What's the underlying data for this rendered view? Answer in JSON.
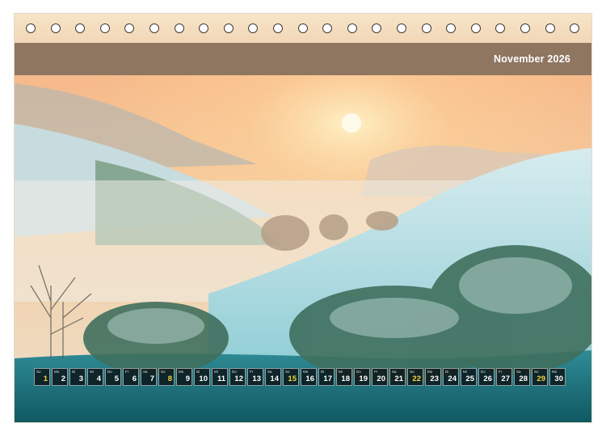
{
  "calendar": {
    "title": "November 2026",
    "days": [
      {
        "wd": "So",
        "n": "1",
        "kind": "sun"
      },
      {
        "wd": "Mo",
        "n": "2",
        "kind": ""
      },
      {
        "wd": "Di",
        "n": "3",
        "kind": ""
      },
      {
        "wd": "Mi",
        "n": "4",
        "kind": ""
      },
      {
        "wd": "Do",
        "n": "5",
        "kind": ""
      },
      {
        "wd": "Fr",
        "n": "6",
        "kind": ""
      },
      {
        "wd": "Sa",
        "n": "7",
        "kind": ""
      },
      {
        "wd": "So",
        "n": "8",
        "kind": "sun"
      },
      {
        "wd": "Mo",
        "n": "9",
        "kind": ""
      },
      {
        "wd": "Di",
        "n": "10",
        "kind": ""
      },
      {
        "wd": "Mi",
        "n": "11",
        "kind": ""
      },
      {
        "wd": "Do",
        "n": "12",
        "kind": ""
      },
      {
        "wd": "Fr",
        "n": "13",
        "kind": ""
      },
      {
        "wd": "Sa",
        "n": "14",
        "kind": ""
      },
      {
        "wd": "So",
        "n": "15",
        "kind": "sun"
      },
      {
        "wd": "Mo",
        "n": "16",
        "kind": ""
      },
      {
        "wd": "Di",
        "n": "17",
        "kind": ""
      },
      {
        "wd": "Mi",
        "n": "18",
        "kind": ""
      },
      {
        "wd": "Do",
        "n": "19",
        "kind": ""
      },
      {
        "wd": "Fr",
        "n": "20",
        "kind": ""
      },
      {
        "wd": "Sa",
        "n": "21",
        "kind": ""
      },
      {
        "wd": "So",
        "n": "22",
        "kind": "sun"
      },
      {
        "wd": "Mo",
        "n": "23",
        "kind": ""
      },
      {
        "wd": "Di",
        "n": "24",
        "kind": ""
      },
      {
        "wd": "Mi",
        "n": "25",
        "kind": ""
      },
      {
        "wd": "Do",
        "n": "26",
        "kind": ""
      },
      {
        "wd": "Fr",
        "n": "27",
        "kind": ""
      },
      {
        "wd": "Sa",
        "n": "28",
        "kind": ""
      },
      {
        "wd": "So",
        "n": "29",
        "kind": "sun"
      },
      {
        "wd": "Mo",
        "n": "30",
        "kind": ""
      }
    ]
  },
  "colors": {
    "title_bar": "#8e7661",
    "highlight_day": "#f2d53c"
  }
}
